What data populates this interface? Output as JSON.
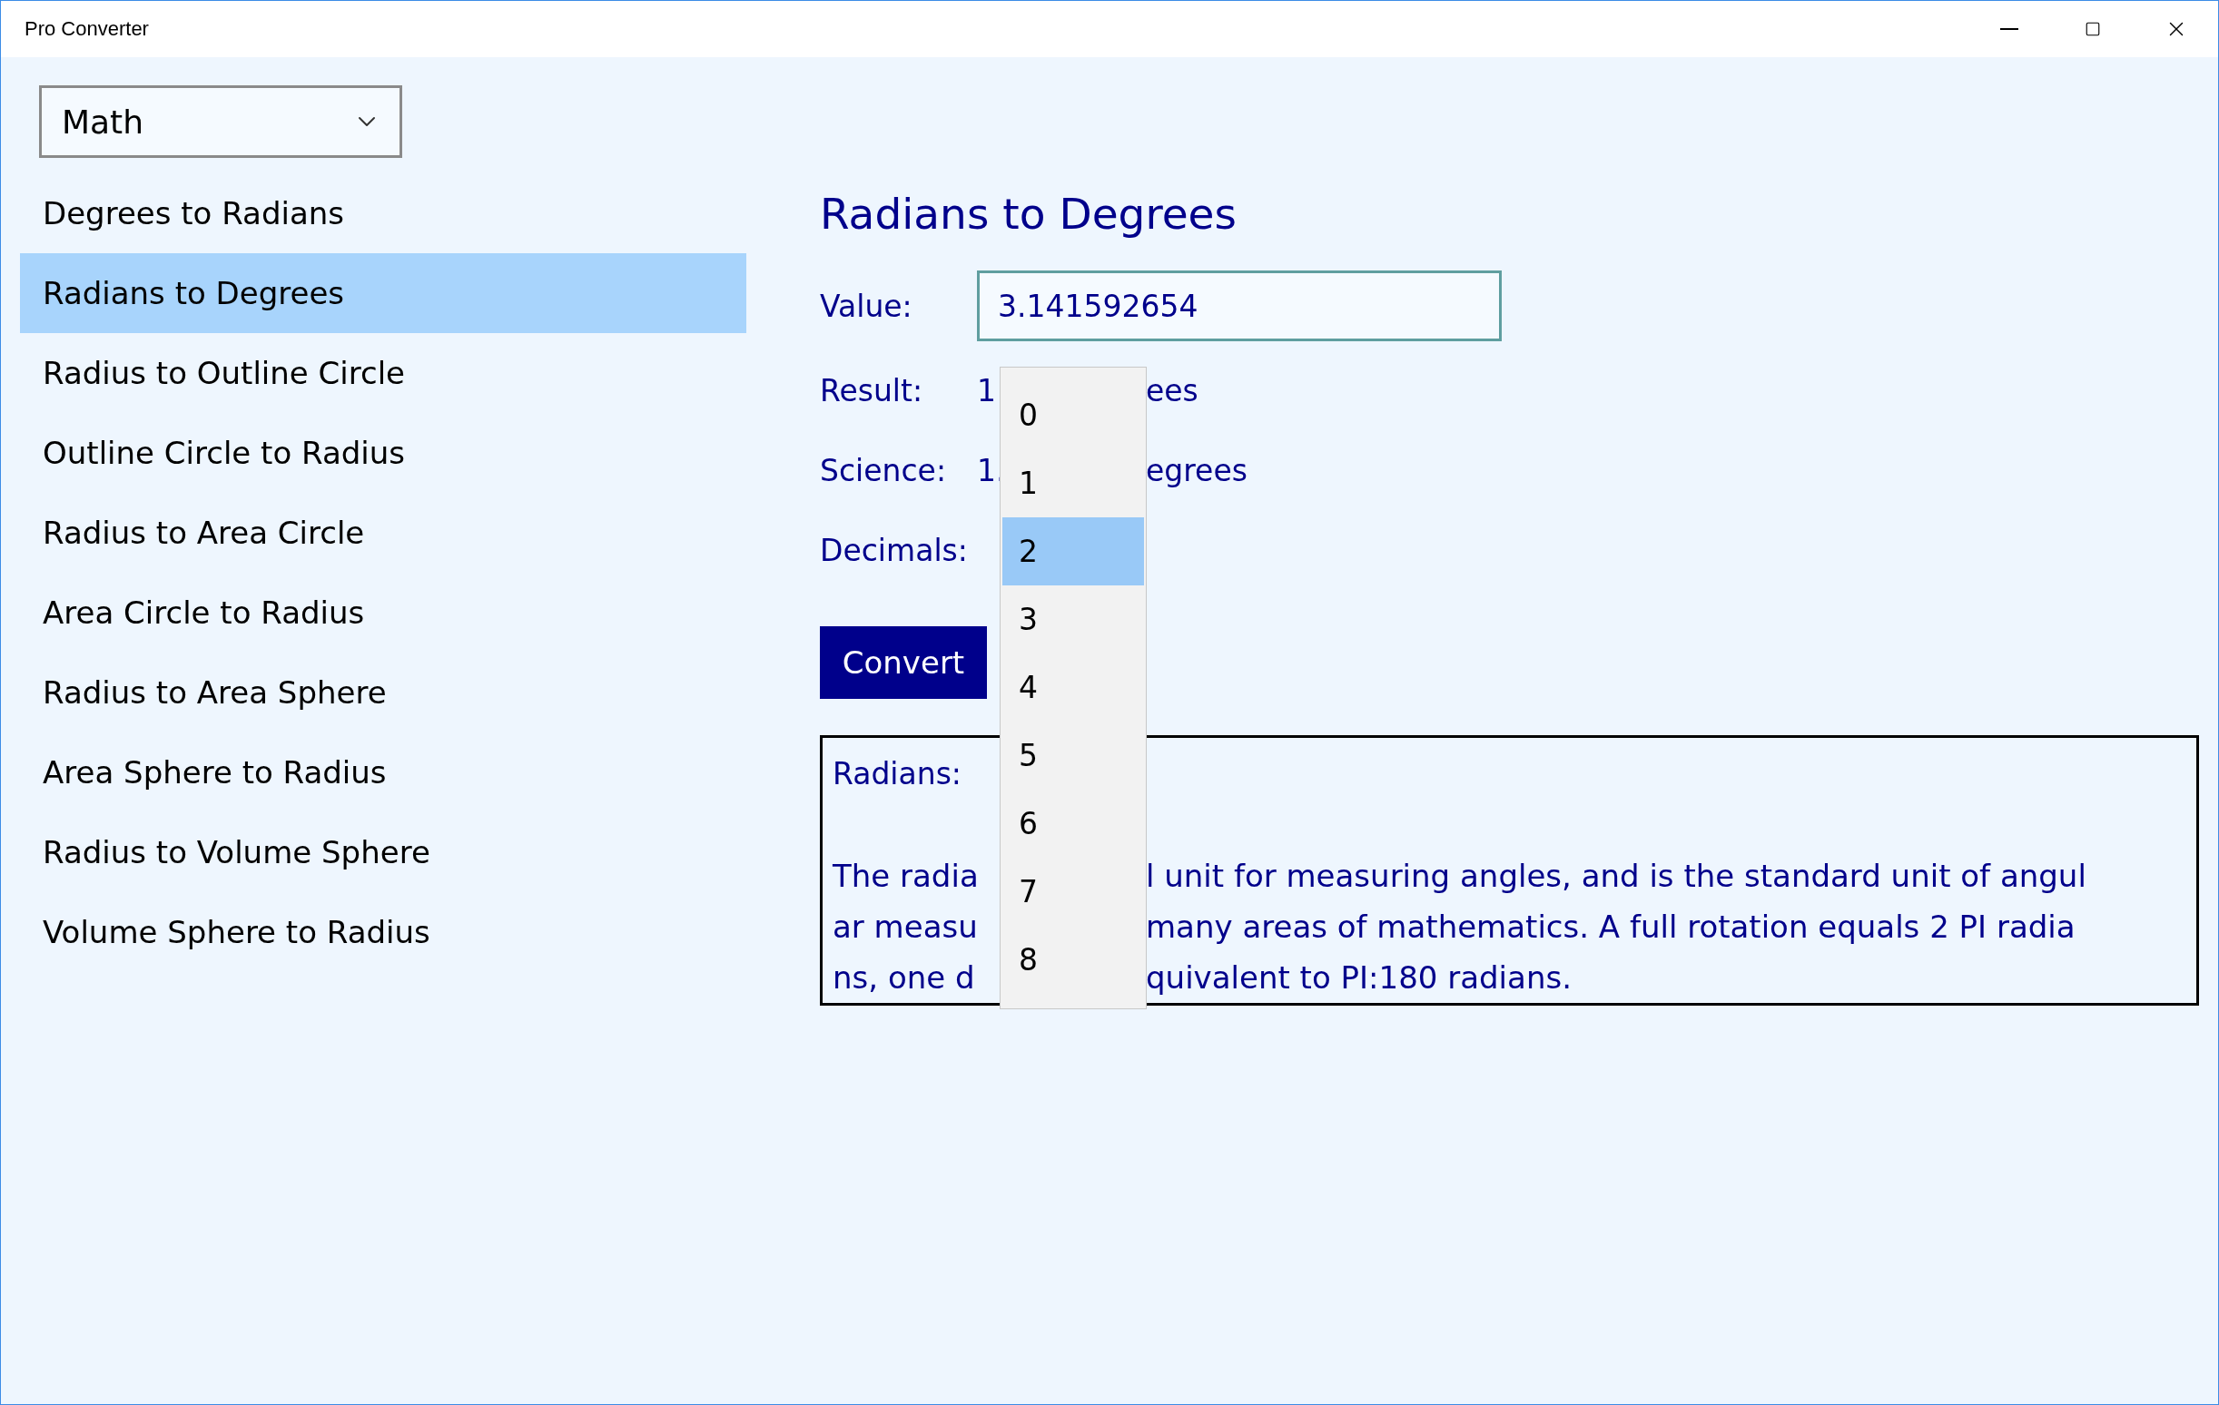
{
  "window": {
    "title": "Pro Converter"
  },
  "category": {
    "value": "Math"
  },
  "conversions": [
    {
      "label": "Degrees to Radians",
      "selected": false
    },
    {
      "label": "Radians to Degrees",
      "selected": true
    },
    {
      "label": "Radius to Outline Circle",
      "selected": false
    },
    {
      "label": "Outline Circle to Radius",
      "selected": false
    },
    {
      "label": "Radius to Area Circle",
      "selected": false
    },
    {
      "label": "Area Circle to Radius",
      "selected": false
    },
    {
      "label": "Radius to Area Sphere",
      "selected": false
    },
    {
      "label": "Area Sphere to Radius",
      "selected": false
    },
    {
      "label": "Radius to Volume Sphere",
      "selected": false
    },
    {
      "label": "Volume Sphere to Radius",
      "selected": false
    }
  ],
  "panel": {
    "title": "Radians to Degrees",
    "value": {
      "label": "Value:",
      "text": "3.141592654"
    },
    "result": {
      "label": "Result:",
      "shown_before": "1",
      "shown_after": "ees"
    },
    "science": {
      "label": "Science:",
      "shown_before": "1.",
      "shown_after": "egrees"
    },
    "decimals": {
      "label": "Decimals:"
    },
    "convert_button": "Convert",
    "description": {
      "heading": "Radians:",
      "lines": [
        {
          "shown_before": "The radia",
          "shown_after": "l unit for measuring angles, and is the standard unit of angul"
        },
        {
          "shown_before": "ar measu",
          "shown_after": "many areas of mathematics. A full rotation equals 2 PI radia"
        },
        {
          "shown_before": "ns, one d",
          "shown_after": "quivalent to PI:180 radians."
        }
      ]
    }
  },
  "decimals_dropdown": {
    "options": [
      {
        "label": "0",
        "selected": false
      },
      {
        "label": "1",
        "selected": false
      },
      {
        "label": "2",
        "selected": true
      },
      {
        "label": "3",
        "selected": false
      },
      {
        "label": "4",
        "selected": false
      },
      {
        "label": "5",
        "selected": false
      },
      {
        "label": "6",
        "selected": false
      },
      {
        "label": "7",
        "selected": false
      },
      {
        "label": "8",
        "selected": false
      }
    ]
  }
}
